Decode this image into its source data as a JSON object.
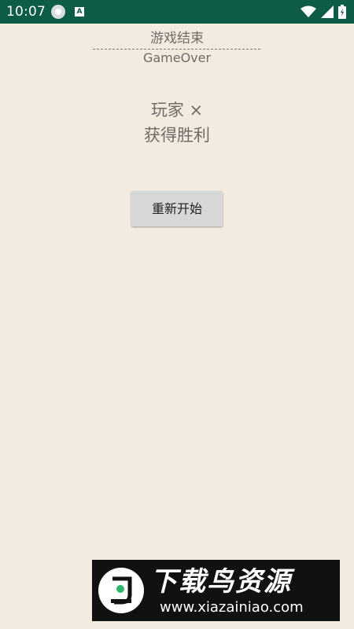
{
  "status_bar": {
    "time": "10:07",
    "app_icon_letter": "A",
    "icons": [
      "record-icon",
      "a-icon",
      "wifi-icon",
      "signal-icon",
      "battery-icon"
    ]
  },
  "game_over": {
    "title_cn": "游戏结束",
    "title_en": "GameOver",
    "player_text": "玩家 ×",
    "result_text": "获得胜利",
    "restart_label": "重新开始"
  },
  "watermark": {
    "brand": "下载鸟资源",
    "url": "www.xiazainiao.com"
  },
  "colors": {
    "status_bar": "#0d5c46",
    "background": "#f3ebe0",
    "text": "#6f6b67",
    "button": "#d6d7d7"
  }
}
